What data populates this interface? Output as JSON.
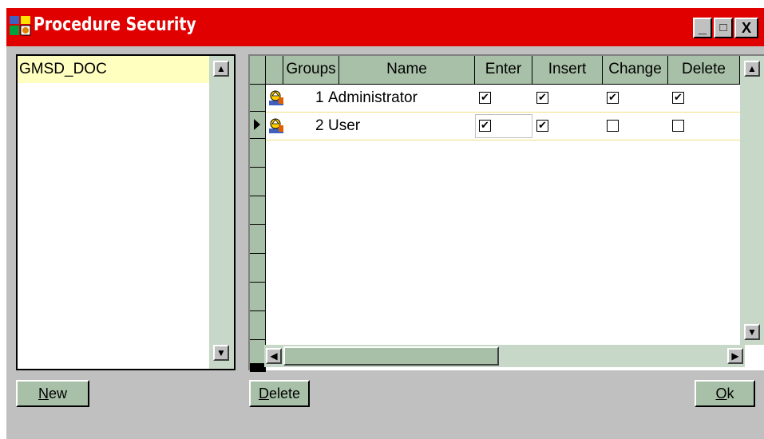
{
  "window": {
    "title": "Procedure Security",
    "controls": {
      "minimize": "_",
      "maximize": "□",
      "close": "X"
    }
  },
  "list": {
    "items": [
      "GMSD_DOC"
    ]
  },
  "grid": {
    "columns": [
      "Groups",
      "Name",
      "Enter",
      "Insert",
      "Change",
      "Delete"
    ],
    "rows": [
      {
        "id": "1",
        "name": "Administrator",
        "enter": true,
        "insert": true,
        "change": true,
        "delete": true
      },
      {
        "id": "2",
        "name": "User",
        "enter": true,
        "insert": true,
        "change": false,
        "delete": false
      }
    ]
  },
  "buttons": {
    "new": {
      "mnemonic": "N",
      "rest": "ew"
    },
    "delete": {
      "mnemonic": "D",
      "rest": "elete"
    },
    "ok": {
      "mnemonic": "O",
      "rest": "k"
    }
  },
  "colors": {
    "title_bar": "#e00000",
    "selection": "#ffffc0",
    "header": "#a8c0a8"
  }
}
